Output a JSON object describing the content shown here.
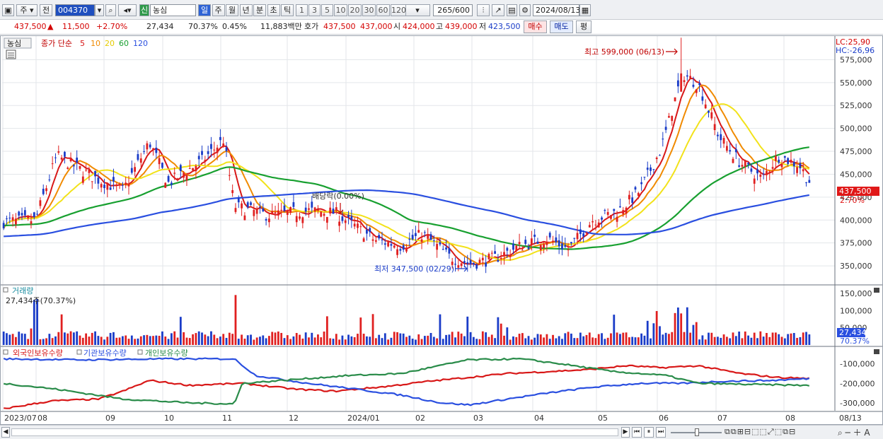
{
  "toolbar": {
    "type_select": "주",
    "prev_label": "전",
    "code": "004370",
    "badge": "신",
    "name": "농심",
    "period_tabs": [
      "일",
      "주",
      "월",
      "년",
      "분",
      "초",
      "틱"
    ],
    "periods": [
      "1",
      "3",
      "5",
      "10",
      "20",
      "30",
      "60",
      "120"
    ],
    "count": "265",
    "count_max": "/600",
    "date": "2024/08/13"
  },
  "quote": {
    "price": "437,500",
    "arrow": "▲",
    "change": "11,500",
    "pct": "+2.70%",
    "volume": "27,434",
    "vol_ratio": "70.37%",
    "turnover": "0.45%",
    "amount": "11,883백만",
    "bid_label": "호가",
    "bid": "437,500",
    "ask": "437,000",
    "open_label": "시",
    "open": "424,000",
    "high_label": "고",
    "high": "439,000",
    "low_label": "저",
    "low": "423,500",
    "buy": "매수",
    "sell": "매도",
    "flat": "평"
  },
  "price_legend": {
    "name": "농심",
    "title": "종가 단순",
    "ma": [
      "5",
      "10",
      "20",
      "60",
      "120"
    ]
  },
  "ma_colors": [
    "#d81818",
    "#f08a00",
    "#f2e21a",
    "#18a030",
    "#2a4fe0"
  ],
  "up_color": "#e02020",
  "down_color": "#1a3cc8",
  "lc": "LC:25,90",
  "hc": "HC:-26,96",
  "price_ticks": [
    "575,000",
    "550,000",
    "525,000",
    "500,000",
    "475,000",
    "450,000",
    "425,000",
    "400,000",
    "375,000",
    "350,000"
  ],
  "price_axis": {
    "min": 330000,
    "max": 600000
  },
  "last_price_tag": "437,500",
  "last_pct_tag": "2.70%",
  "annotations": {
    "high": "최고 599,000 (06/13)",
    "low": "최저 347,500 (02/29)",
    "dividend": "배당락(0.00%)"
  },
  "volume_panel": {
    "title": "거래량",
    "info": "27,434주(70.37%)",
    "ticks": [
      "150,000",
      "100,000",
      "50,000"
    ],
    "last": "27,434",
    "last_pct": "70.37%"
  },
  "holders_panel": {
    "series": [
      "외국인보유수량",
      "기관보유수량",
      "개인보유수량"
    ],
    "colors": [
      "#d81818",
      "#2a4fe0",
      "#2a8c4a"
    ],
    "ticks": [
      "-100,000",
      "-200,000",
      "-300,000"
    ]
  },
  "x_labels": [
    "2023/07",
    "08",
    "09",
    "10",
    "11",
    "12",
    "2024/01",
    "02",
    "03",
    "04",
    "05",
    "06",
    "07",
    "08",
    "08/13"
  ],
  "chart_data": {
    "type": "candlestick",
    "x": [
      "2023/07",
      "08",
      "09",
      "10",
      "11",
      "12",
      "2024/01",
      "02",
      "03",
      "04",
      "05",
      "06",
      "07",
      "08"
    ],
    "close_monthly": [
      398000,
      462000,
      448000,
      440000,
      455000,
      408000,
      412000,
      370000,
      360000,
      375000,
      405000,
      540000,
      462000,
      437500
    ],
    "ma120_monthly": [
      385000,
      395000,
      410000,
      425000,
      435000,
      438000,
      436000,
      432000,
      425000,
      415000,
      405000,
      410000,
      420000,
      428000
    ],
    "high": {
      "value": 599000,
      "date": "06/13"
    },
    "low": {
      "value": 347500,
      "date": "02/29"
    },
    "volume_peak": 145000,
    "ylim": [
      330000,
      600000
    ]
  }
}
